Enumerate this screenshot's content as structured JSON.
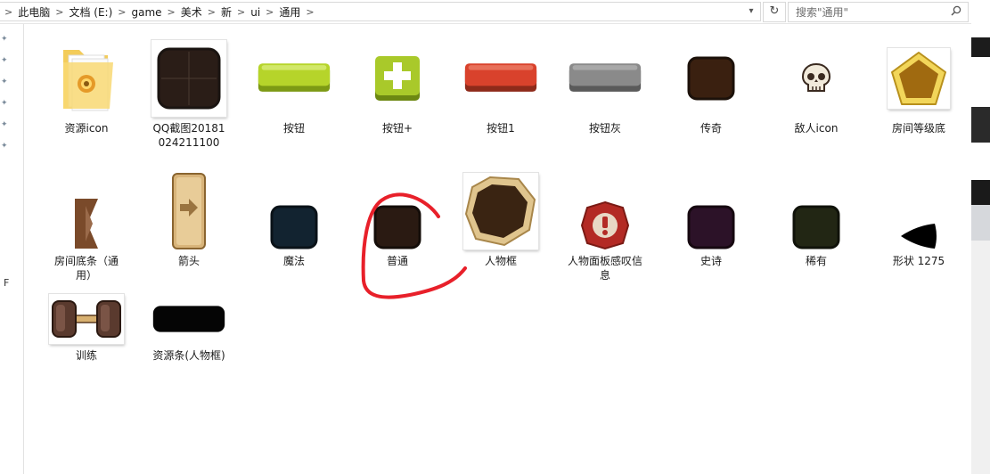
{
  "address_bar": {
    "path": [
      "此电脑",
      "文档 (E:)",
      "game",
      "美术",
      "新",
      "ui",
      "通用"
    ],
    "separator": ">"
  },
  "search": {
    "placeholder": "搜索\"通用\""
  },
  "nav": {
    "partial_label": "F"
  },
  "files": [
    {
      "name": "资源icon",
      "icon": "folder-icon"
    },
    {
      "name": "QQ截图20181024211100",
      "icon": "dark-panel-thumbnail"
    },
    {
      "name": "按钮",
      "icon": "green-button-thumbnail"
    },
    {
      "name": "按钮+",
      "icon": "green-plus-button-thumbnail"
    },
    {
      "name": "按钮1",
      "icon": "red-button-thumbnail"
    },
    {
      "name": "按钮灰",
      "icon": "gray-button-thumbnail"
    },
    {
      "name": "传奇",
      "icon": "brown-square-thumbnail"
    },
    {
      "name": "敌人icon",
      "icon": "skull-icon"
    },
    {
      "name": "房间等级底",
      "icon": "gold-pentagon-thumbnail"
    },
    {
      "name": "房间底条（通用）",
      "icon": "bookmark-strip-thumbnail"
    },
    {
      "name": "箭头",
      "icon": "arrow-panel-thumbnail"
    },
    {
      "name": "魔法",
      "icon": "navy-square-thumbnail"
    },
    {
      "name": "普通",
      "icon": "dark-brown-square-thumbnail"
    },
    {
      "name": "人物框",
      "icon": "character-frame-thumbnail"
    },
    {
      "name": "人物面板感叹信息",
      "icon": "exclamation-badge-thumbnail"
    },
    {
      "name": "史诗",
      "icon": "purple-square-thumbnail"
    },
    {
      "name": "稀有",
      "icon": "olive-square-thumbnail"
    },
    {
      "name": "形状 1275",
      "icon": "black-shape-thumbnail"
    },
    {
      "name": "训练",
      "icon": "dumbbell-thumbnail"
    },
    {
      "name": "资源条(人物框)",
      "icon": "black-bar-thumbnail"
    }
  ],
  "colors": {
    "annotation": "#e8202a",
    "green_button": "#b6d42a",
    "red_button": "#d9422c",
    "gray_button": "#8a8a8a",
    "gold": "#c8962a"
  }
}
